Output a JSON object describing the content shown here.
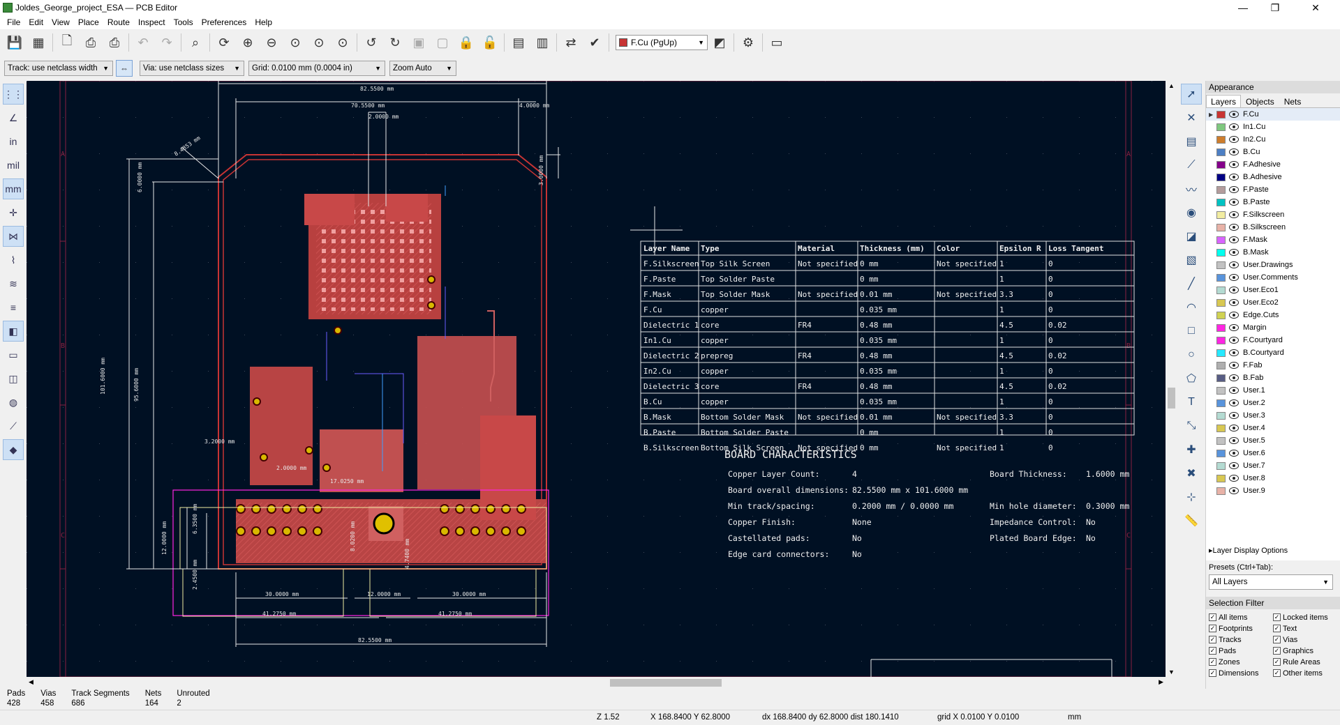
{
  "window": {
    "title": "Joldes_George_project_ESA — PCB Editor",
    "minimize": "—",
    "maximize": "❐",
    "close": "✕"
  },
  "menu": [
    "File",
    "Edit",
    "View",
    "Place",
    "Route",
    "Inspect",
    "Tools",
    "Preferences",
    "Help"
  ],
  "toolbar": {
    "active_layer": "F.Cu (PgUp)",
    "active_layer_color": "#c83434"
  },
  "toolbar2": {
    "track": "Track: use netclass width",
    "via": "Via: use netclass sizes",
    "grid": "Grid: 0.0100 mm (0.0004 in)",
    "zoom": "Zoom Auto"
  },
  "left_tools": {
    "units_in": "in",
    "units_mil": "mil",
    "units_mm": "mm"
  },
  "canvas": {
    "frame_rows": [
      "A",
      "B",
      "C"
    ],
    "dims": {
      "overall_width": "82.5500 mm",
      "inner_width": "70.5500 mm",
      "right_offset": "4.0000 mm",
      "top_small": "2.0000 mm",
      "chamfer": "8.4853 mm",
      "top_margin": "6.0000 mm",
      "corner_small": "3.0000 mm",
      "height_outer": "101.6000 mm",
      "height_inner": "95.6000 mm",
      "left_marker": "3.2000 mm",
      "mid_small": "2.0000 mm",
      "mid_a": "2.0000 mm",
      "mid_b": "17.0250 mm",
      "conn_h": "12.0000 mm",
      "conn_a": "6.3500 mm",
      "conn_b": "2.4500 mm",
      "conn_c": "8.0200 mm",
      "conn_d": "4.7400 mm",
      "bottom_left": "30.0000 mm",
      "bottom_mid": "12.0000 mm",
      "bottom_right": "30.0000 mm",
      "bottom_span_l": "41.2750 mm",
      "bottom_span_r": "41.2750 mm",
      "bottom_overall": "82.5500 mm"
    }
  },
  "stackup": {
    "headers": [
      "Layer Name",
      "Type",
      "Material",
      "Thickness (mm)",
      "Color",
      "Epsilon R",
      "Loss Tangent"
    ],
    "rows": [
      [
        "F.Silkscreen",
        "Top Silk Screen",
        "Not specified",
        "0 mm",
        "Not specified",
        "1",
        "0"
      ],
      [
        "F.Paste",
        "Top Solder Paste",
        "",
        "0 mm",
        "",
        "1",
        "0"
      ],
      [
        "F.Mask",
        "Top Solder Mask",
        "Not specified",
        "0.01 mm",
        "Not specified",
        "3.3",
        "0"
      ],
      [
        "F.Cu",
        "copper",
        "",
        "0.035 mm",
        "",
        "1",
        "0"
      ],
      [
        "Dielectric 1",
        "core",
        "FR4",
        "0.48 mm",
        "",
        "4.5",
        "0.02"
      ],
      [
        "In1.Cu",
        "copper",
        "",
        "0.035 mm",
        "",
        "1",
        "0"
      ],
      [
        "Dielectric 2",
        "prepreg",
        "FR4",
        "0.48 mm",
        "",
        "4.5",
        "0.02"
      ],
      [
        "In2.Cu",
        "copper",
        "",
        "0.035 mm",
        "",
        "1",
        "0"
      ],
      [
        "Dielectric 3",
        "core",
        "FR4",
        "0.48 mm",
        "",
        "4.5",
        "0.02"
      ],
      [
        "B.Cu",
        "copper",
        "",
        "0.035 mm",
        "",
        "1",
        "0"
      ],
      [
        "B.Mask",
        "Bottom Solder Mask",
        "Not specified",
        "0.01 mm",
        "Not specified",
        "3.3",
        "0"
      ],
      [
        "B.Paste",
        "Bottom Solder Paste",
        "",
        "0 mm",
        "",
        "1",
        "0"
      ],
      [
        "B.Silkscreen",
        "Bottom Silk Screen",
        "Not specified",
        "0 mm",
        "Not specified",
        "1",
        "0"
      ]
    ]
  },
  "board_char": {
    "title": "BOARD CHARACTERISTICS",
    "left": [
      [
        "Copper Layer Count:",
        "4"
      ],
      [
        "Board overall dimensions:",
        "82.5500 mm x 101.6000 mm"
      ],
      [
        "Min track/spacing:",
        "0.2000 mm / 0.0000 mm"
      ],
      [
        "Copper Finish:",
        "None"
      ],
      [
        "Castellated pads:",
        "No"
      ],
      [
        "Edge card connectors:",
        "No"
      ]
    ],
    "right": [
      [
        "Board Thickness:",
        "1.6000 mm"
      ],
      [
        "",
        ""
      ],
      [
        "Min hole diameter:",
        "0.3000 mm"
      ],
      [
        "Impedance Control:",
        "No"
      ],
      [
        "Plated Board Edge:",
        "No"
      ]
    ]
  },
  "appearance": {
    "title": "Appearance",
    "tabs": [
      "Layers",
      "Objects",
      "Nets"
    ],
    "layers": [
      {
        "name": "F.Cu",
        "color": "#c83434"
      },
      {
        "name": "In1.Cu",
        "color": "#7fc87f"
      },
      {
        "name": "In2.Cu",
        "color": "#ce7d2c"
      },
      {
        "name": "B.Cu",
        "color": "#4d7fc4"
      },
      {
        "name": "F.Adhesive",
        "color": "#84008a"
      },
      {
        "name": "B.Adhesive",
        "color": "#000084"
      },
      {
        "name": "F.Paste",
        "color": "#b49c9c"
      },
      {
        "name": "B.Paste",
        "color": "#00c2c2"
      },
      {
        "name": "F.Silkscreen",
        "color": "#f2eda1"
      },
      {
        "name": "B.Silkscreen",
        "color": "#e8b2a7"
      },
      {
        "name": "F.Mask",
        "color": "#d864ff"
      },
      {
        "name": "B.Mask",
        "color": "#02ffee"
      },
      {
        "name": "User.Drawings",
        "color": "#c2c2c2"
      },
      {
        "name": "User.Comments",
        "color": "#5994dc"
      },
      {
        "name": "User.Eco1",
        "color": "#b4dbd2"
      },
      {
        "name": "User.Eco2",
        "color": "#d8c852"
      },
      {
        "name": "Edge.Cuts",
        "color": "#d0d252"
      },
      {
        "name": "Margin",
        "color": "#ff26e2"
      },
      {
        "name": "F.Courtyard",
        "color": "#ff26e2"
      },
      {
        "name": "B.Courtyard",
        "color": "#26e9ff"
      },
      {
        "name": "F.Fab",
        "color": "#afafaf"
      },
      {
        "name": "B.Fab",
        "color": "#585d84"
      },
      {
        "name": "User.1",
        "color": "#c2c2c2"
      },
      {
        "name": "User.2",
        "color": "#5994dc"
      },
      {
        "name": "User.3",
        "color": "#b4dbd2"
      },
      {
        "name": "User.4",
        "color": "#d8c852"
      },
      {
        "name": "User.5",
        "color": "#c2c2c2"
      },
      {
        "name": "User.6",
        "color": "#5994dc"
      },
      {
        "name": "User.7",
        "color": "#b4dbd2"
      },
      {
        "name": "User.8",
        "color": "#d8c852"
      },
      {
        "name": "User.9",
        "color": "#e8b2a7"
      }
    ],
    "layer_display_options": "Layer Display Options",
    "presets_label": "Presets (Ctrl+Tab):",
    "presets_value": "All Layers",
    "selection_filter_title": "Selection Filter",
    "selection_filter": [
      "All items",
      "Locked items",
      "Footprints",
      "Text",
      "Tracks",
      "Vias",
      "Pads",
      "Graphics",
      "Zones",
      "Rule Areas",
      "Dimensions",
      "Other items"
    ]
  },
  "messages": [
    {
      "label": "Pads",
      "value": "428"
    },
    {
      "label": "Vias",
      "value": "458"
    },
    {
      "label": "Track Segments",
      "value": "686"
    },
    {
      "label": "Nets",
      "value": "164"
    },
    {
      "label": "Unrouted",
      "value": "2"
    }
  ],
  "status": {
    "zoom": "Z 1.52",
    "pos": "X 168.8400  Y 62.8000",
    "delta": "dx 168.8400  dy 62.8000  dist 180.1410",
    "grid": "grid X 0.0100  Y 0.0100",
    "units": "mm"
  }
}
